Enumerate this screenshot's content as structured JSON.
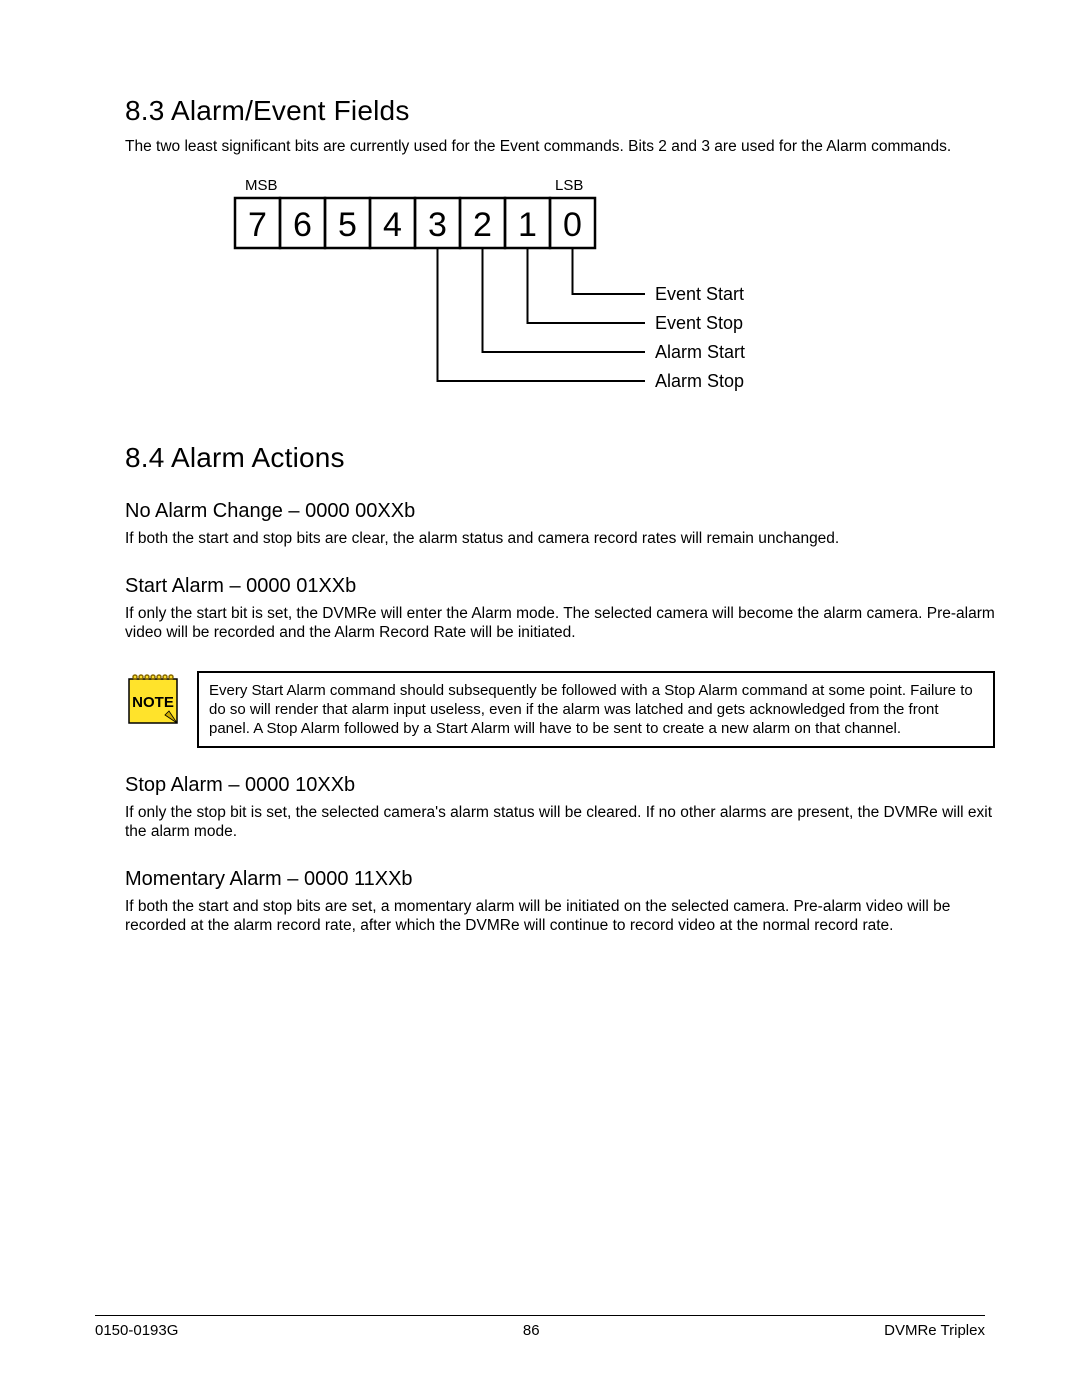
{
  "sections": {
    "s83": {
      "heading": "8.3 Alarm/Event Fields",
      "para": "The two least significant bits are currently used for the Event commands.  Bits 2 and 3 are used for the Alarm commands."
    },
    "diagram": {
      "msb": "MSB",
      "lsb": "LSB",
      "bits": [
        "7",
        "6",
        "5",
        "4",
        "3",
        "2",
        "1",
        "0"
      ],
      "leads": [
        {
          "bit": 0,
          "text": "Event Start"
        },
        {
          "bit": 1,
          "text": "Event Stop"
        },
        {
          "bit": 2,
          "text": "Alarm Start"
        },
        {
          "bit": 3,
          "text": "Alarm Stop"
        }
      ]
    },
    "s84": {
      "heading": "8.4 Alarm Actions",
      "items": {
        "noChange": {
          "heading": "No Alarm Change – 0000 00XXb",
          "para": "If both the start and stop bits are clear, the alarm status and camera record rates will remain unchanged."
        },
        "start": {
          "heading": "Start Alarm – 0000 01XXb",
          "para": "If only the start bit is set, the DVMRe will enter the Alarm mode. The selected camera will become the alarm camera. Pre-alarm video will be recorded and the Alarm Record Rate will be initiated."
        },
        "note": "Every Start Alarm command should subsequently be followed with a Stop Alarm command at some point. Failure to do so will render that alarm input useless, even if the alarm was latched and gets acknowledged from the front panel. A Stop Alarm followed by a Start Alarm will have to be sent to create a new alarm on that channel.",
        "stop": {
          "heading": "Stop Alarm – 0000 10XXb",
          "para": "If only the stop bit is set, the selected camera's alarm status will be cleared. If no other alarms are present, the DVMRe will exit the alarm mode."
        },
        "momentary": {
          "heading": "Momentary Alarm – 0000 11XXb",
          "para": "If both the start and stop bits are set, a momentary alarm will be initiated on the selected camera. Pre-alarm video will be recorded at the alarm record rate, after which the DVMRe will continue to record video at the normal record rate."
        }
      }
    },
    "noteWord": "NOTE",
    "footer": {
      "left": "0150-0193G",
      "center": "86",
      "right": "DVMRe Triplex"
    }
  }
}
